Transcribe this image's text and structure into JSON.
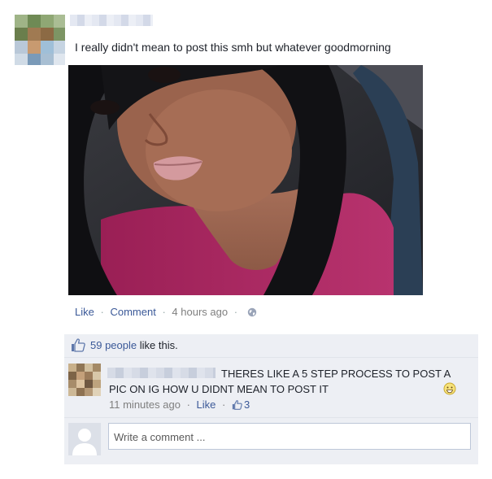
{
  "post": {
    "author_avatar_icon": "user-avatar-blurred",
    "status_text": "I really didn't mean to post this smh but whatever goodmorning",
    "photo_icon": "selfie-photo",
    "actions": {
      "like": "Like",
      "comment": "Comment",
      "time": "4 hours ago",
      "privacy_icon": "globe-icon"
    }
  },
  "likes": {
    "icon": "thumbs-up-icon",
    "count_link": "59 people",
    "suffix": " like this."
  },
  "comment": {
    "avatar_icon": "commenter-avatar-blurred",
    "text": "THERES LIKE A 5 STEP PROCESS TO POST A PIC ON IG HOW U DIDNT MEAN TO POST IT",
    "emoji_icon": "smile-emoji",
    "time": "11 minutes ago",
    "like": "Like",
    "like_count": "3"
  },
  "composer": {
    "placeholder": "Write a comment ..."
  },
  "colors": {
    "link": "#3b5998",
    "comment_bg": "#edeff4",
    "meta": "#7f7f7f"
  }
}
